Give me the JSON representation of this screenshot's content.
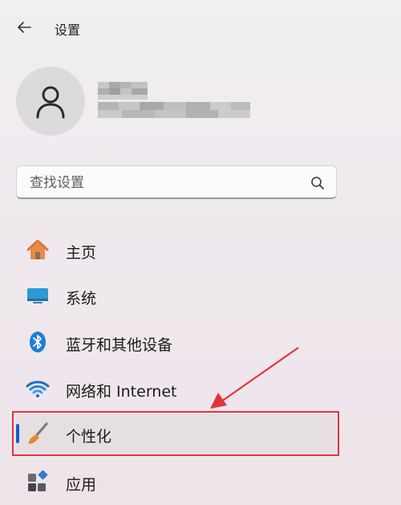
{
  "header": {
    "title": "设置"
  },
  "account": {
    "name": "",
    "email": ""
  },
  "search": {
    "placeholder": "查找设置"
  },
  "nav": [
    {
      "label": "主页",
      "icon": "home-icon"
    },
    {
      "label": "系统",
      "icon": "system-display-icon"
    },
    {
      "label": "蓝牙和其他设备",
      "icon": "bluetooth-icon"
    },
    {
      "label": "网络和 Internet",
      "icon": "wifi-icon"
    },
    {
      "label": "个性化",
      "icon": "paintbrush-icon",
      "selected": true
    },
    {
      "label": "应用",
      "icon": "apps-icon"
    }
  ],
  "colors": {
    "accent": "#1a5ac8",
    "annotation": "#e0353a"
  }
}
